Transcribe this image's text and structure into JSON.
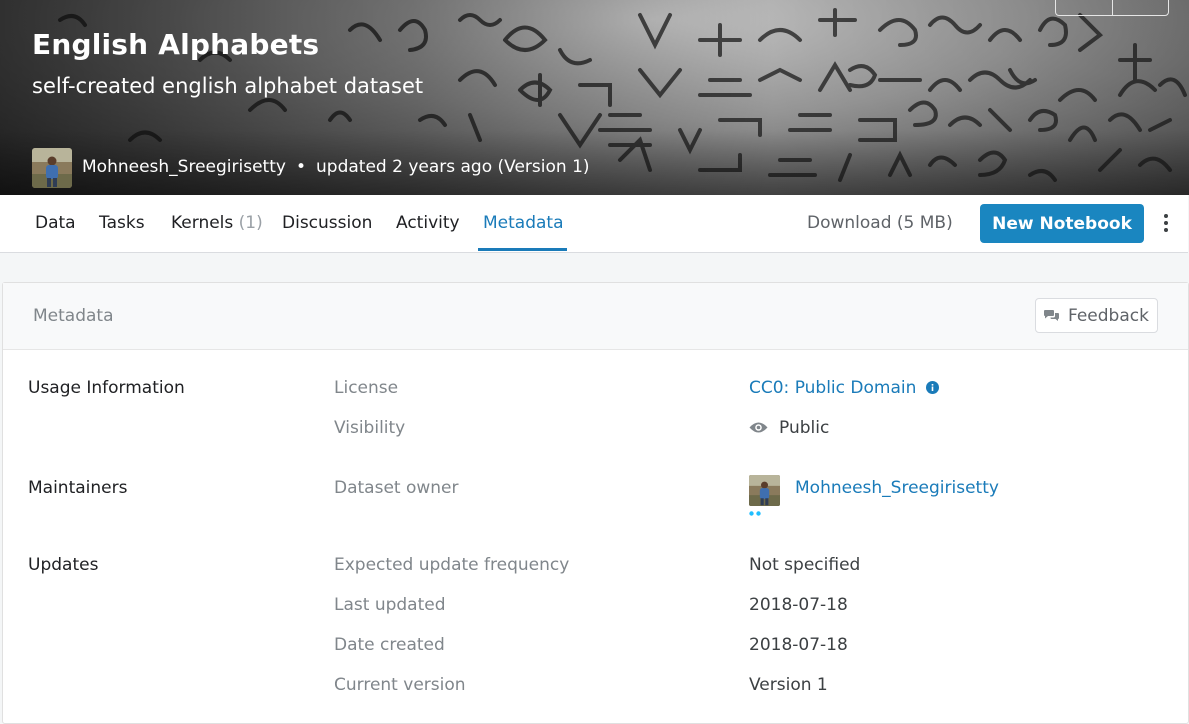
{
  "header": {
    "title": "English Alphabets",
    "subtitle": "self-created english alphabet dataset",
    "owner": "Mohneesh_Sreegirisetty",
    "separator": "•",
    "updated": "updated 2 years ago (Version 1)"
  },
  "tabs": [
    {
      "label": "Data"
    },
    {
      "label": "Tasks"
    },
    {
      "label": "Kernels",
      "count": "(1)"
    },
    {
      "label": "Discussion"
    },
    {
      "label": "Activity"
    },
    {
      "label": "Metadata",
      "active": true
    }
  ],
  "actions": {
    "download": "Download (5 MB)",
    "new_notebook": "New Notebook"
  },
  "panel": {
    "title": "Metadata",
    "feedback": "Feedback"
  },
  "usage": {
    "section": "Usage Information",
    "license_label": "License",
    "license_value": "CC0: Public Domain",
    "visibility_label": "Visibility",
    "visibility_value": "Public"
  },
  "maintainers": {
    "section": "Maintainers",
    "owner_label": "Dataset owner",
    "owner_value": "Mohneesh_Sreegirisetty"
  },
  "updates": {
    "section": "Updates",
    "frequency_label": "Expected update frequency",
    "frequency_value": "Not specified",
    "last_updated_label": "Last updated",
    "last_updated_value": "2018-07-18",
    "created_label": "Date created",
    "created_value": "2018-07-18",
    "version_label": "Current version",
    "version_value": "Version 1"
  },
  "colors": {
    "accent": "#1a7bb9",
    "button": "#1a86c0"
  },
  "icons": [
    "info-icon",
    "eye-icon",
    "chat-icon",
    "more-vert-icon"
  ]
}
